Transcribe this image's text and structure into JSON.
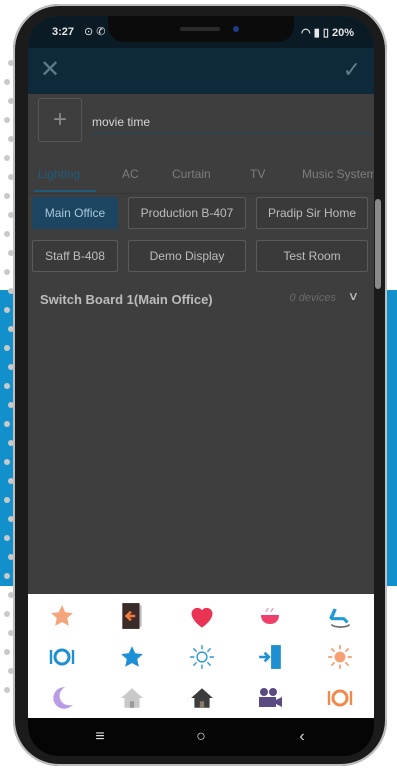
{
  "status": {
    "time": "3:27",
    "left_icons": "⊙ ✆",
    "battery_text": "20%"
  },
  "appbar": {
    "close_icon": "close-icon",
    "confirm_icon": "check-icon"
  },
  "scene": {
    "add_label": "+",
    "name_value": "movie time"
  },
  "tabs": [
    {
      "label": "Lighting",
      "active": true
    },
    {
      "label": "AC",
      "active": false
    },
    {
      "label": "Curtain",
      "active": false
    },
    {
      "label": "TV",
      "active": false
    },
    {
      "label": "Music System",
      "active": false
    }
  ],
  "rooms": [
    {
      "label": "Main Office",
      "selected": true
    },
    {
      "label": "Production B-407",
      "selected": false
    },
    {
      "label": "Pradip Sir Home",
      "selected": false
    },
    {
      "label": "Staff B-408",
      "selected": false
    },
    {
      "label": "Demo Display",
      "selected": false
    },
    {
      "label": "Test Room",
      "selected": false
    }
  ],
  "switch_board": {
    "title": "Switch Board 1(Main Office)",
    "count": "0 devices"
  },
  "icon_panel": {
    "icons": [
      "star-icon",
      "door-exit-icon",
      "heart-icon",
      "bowl-icon",
      "recliner-icon",
      "dining-icon",
      "star-icon",
      "sun-outline-icon",
      "door-enter-icon",
      "sun-icon",
      "moon-icon",
      "home-icon",
      "home-icon",
      "movie-camera-icon",
      "dining-icon"
    ]
  },
  "navbar": {
    "recents_icon": "menu-icon",
    "home_icon": "circle-home-icon",
    "back_icon": "back-icon"
  }
}
